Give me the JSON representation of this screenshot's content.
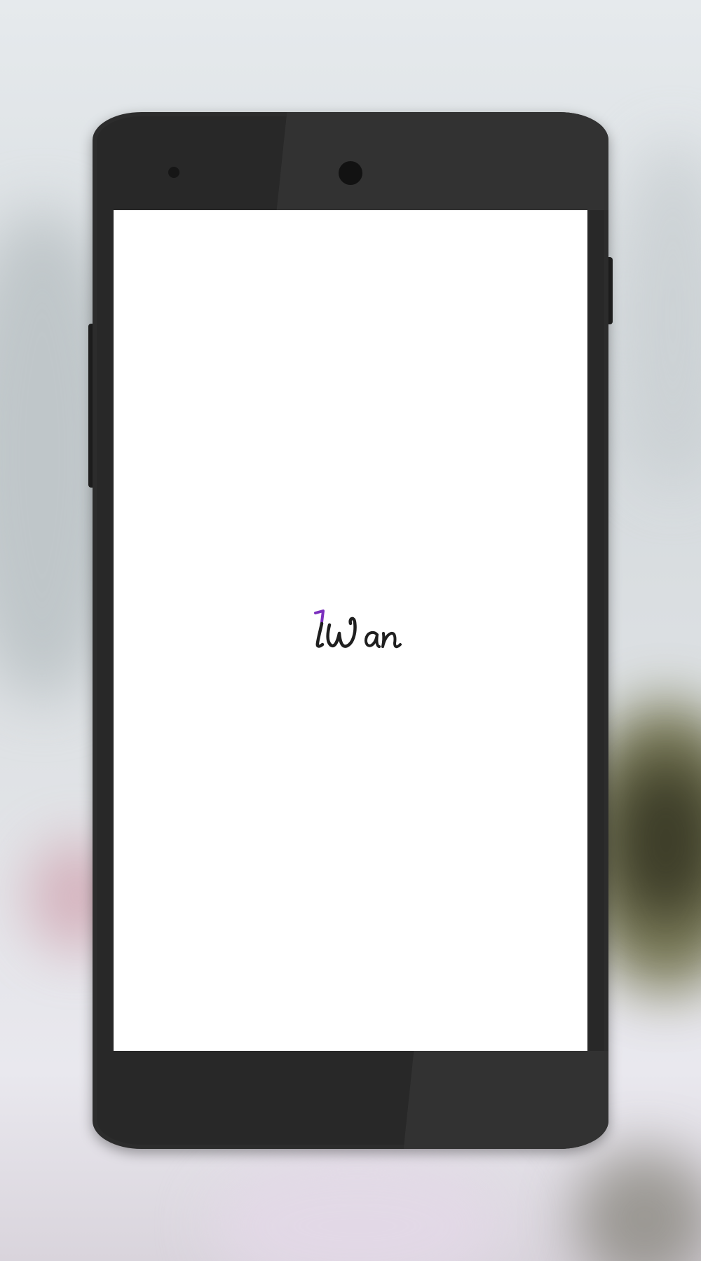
{
  "app": {
    "logo_text": "iWan",
    "logo_accent_color": "#7b2fbe",
    "logo_ink_color": "#1f1f1f"
  },
  "screen": {
    "state": "splash",
    "background_color": "#ffffff"
  }
}
